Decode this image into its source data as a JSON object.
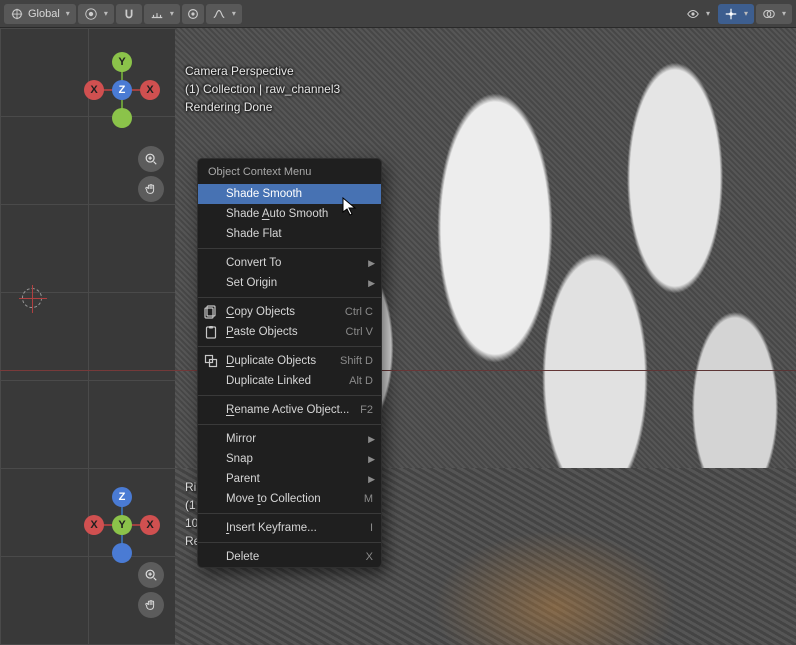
{
  "header": {
    "orientation_label": "Global",
    "right_icons": [
      "visibility-icon",
      "overlays-icon",
      "shading-icon"
    ]
  },
  "viewport_top": {
    "line1": "Camera Perspective",
    "line2": "(1) Collection | raw_channel3",
    "line3": "Rendering Done"
  },
  "viewport_bottom": {
    "line1": "Ri",
    "line2": "(1",
    "line3": "10",
    "line4": "Re"
  },
  "gizmo_top": {
    "center": "Z",
    "left": "X",
    "right": "X",
    "top": "Y",
    "bottom": ""
  },
  "gizmo_bot": {
    "center": "Y",
    "left": "X",
    "right": "X",
    "top": "Z",
    "bottom": ""
  },
  "context_menu": {
    "title": "Object Context Menu",
    "items": [
      {
        "label": "Shade Smooth",
        "shortcut": "",
        "submenu": false,
        "icon": "",
        "hover": true
      },
      {
        "label": "Shade Auto Smooth",
        "shortcut": "",
        "submenu": false,
        "icon": "",
        "underline_idx": 6
      },
      {
        "label": "Shade Flat",
        "shortcut": "",
        "submenu": false,
        "icon": ""
      },
      {
        "sep": true
      },
      {
        "label": "Convert To",
        "shortcut": "",
        "submenu": true,
        "icon": ""
      },
      {
        "label": "Set Origin",
        "shortcut": "",
        "submenu": true,
        "icon": ""
      },
      {
        "sep": true
      },
      {
        "label": "Copy Objects",
        "shortcut": "Ctrl C",
        "submenu": false,
        "icon": "copy-icon",
        "underline_idx": 0
      },
      {
        "label": "Paste Objects",
        "shortcut": "Ctrl V",
        "submenu": false,
        "icon": "paste-icon",
        "underline_idx": 0
      },
      {
        "sep": true
      },
      {
        "label": "Duplicate Objects",
        "shortcut": "Shift D",
        "submenu": false,
        "icon": "duplicate-icon",
        "underline_idx": 0
      },
      {
        "label": "Duplicate Linked",
        "shortcut": "Alt D",
        "submenu": false,
        "icon": ""
      },
      {
        "sep": true
      },
      {
        "label": "Rename Active Object...",
        "shortcut": "F2",
        "submenu": false,
        "icon": "",
        "underline_idx": 0
      },
      {
        "sep": true
      },
      {
        "label": "Mirror",
        "shortcut": "",
        "submenu": true,
        "icon": ""
      },
      {
        "label": "Snap",
        "shortcut": "",
        "submenu": true,
        "icon": ""
      },
      {
        "label": "Parent",
        "shortcut": "",
        "submenu": true,
        "icon": ""
      },
      {
        "label": "Move to Collection",
        "shortcut": "M",
        "submenu": false,
        "icon": "",
        "underline_idx": 5
      },
      {
        "sep": true
      },
      {
        "label": "Insert Keyframe...",
        "shortcut": "I",
        "submenu": false,
        "icon": "",
        "underline_idx": 0
      },
      {
        "sep": true
      },
      {
        "label": "Delete",
        "shortcut": "X",
        "submenu": false,
        "icon": ""
      }
    ]
  }
}
